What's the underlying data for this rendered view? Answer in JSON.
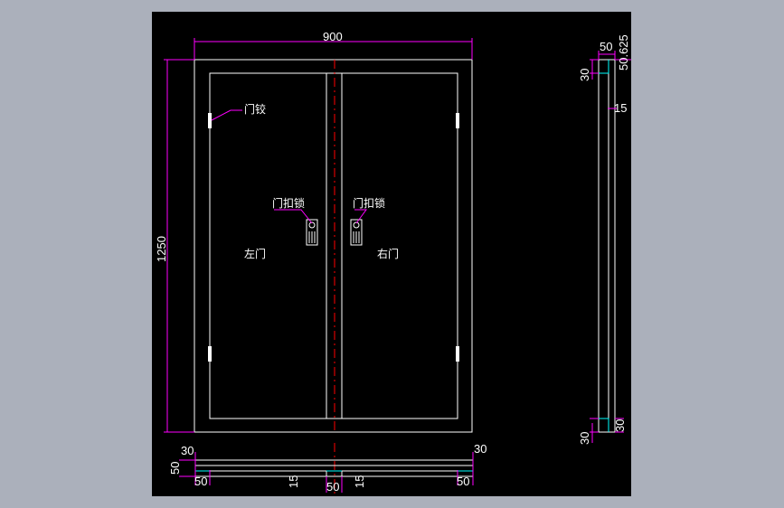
{
  "drawing": {
    "title": "",
    "width_dim": "900",
    "height_dim": "1250",
    "labels": {
      "hinge": "门铰",
      "lock_left": "门扣锁",
      "lock_right": "门扣锁",
      "left_door": "左门",
      "right_door": "右门"
    },
    "bottom_dims": {
      "d30_left": "30",
      "d50_side": "50",
      "d50_left": "50",
      "d15_a": "15",
      "d50_center": "50",
      "d15_b": "15",
      "d50_right": "50",
      "d30_right": "30"
    },
    "side_dims": {
      "d50_top": "50",
      "d50625": "50.625",
      "d30_top": "30",
      "d15": "15",
      "d30_bottom_a": "30",
      "d30_bottom_b": "30"
    },
    "colors": {
      "background": "#abb0bb",
      "canvas": "#000000",
      "line": "#ffffff",
      "dimension": "#ff00ff",
      "centerline": "#ff0000",
      "section": "#00ffff"
    }
  }
}
